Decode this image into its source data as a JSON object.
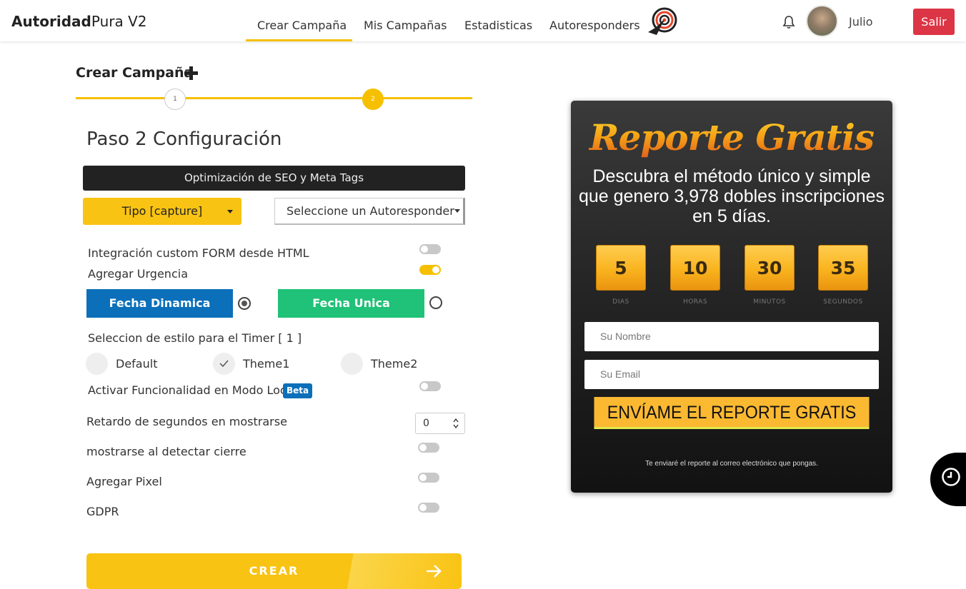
{
  "brand": {
    "bold": "Autoridad",
    "light": "Pura V2"
  },
  "nav": {
    "links": [
      "Crear Campaña",
      "Mis Campañas",
      "Estadisticas",
      "Autoresponders"
    ],
    "user": "Julio",
    "logout": "Salir",
    "accent": "#f6c000"
  },
  "form": {
    "title": "Crear Campaña",
    "steps": [
      "1",
      "2"
    ],
    "heading": "Paso 2 Configuración",
    "seo_bar": "Optimización de SEO y Meta Tags",
    "tipo": "Tipo [capture]",
    "autoresponder": "Seleccione un Autoresponder",
    "custom_form": "Integración custom FORM desde HTML",
    "urgencia": "Agregar Urgencia",
    "fecha_dinamica": "Fecha Dinamica",
    "fecha_unica": "Fecha Unica",
    "timer_style": "Seleccion de estilo para el Timer [ 1 ]",
    "themes": [
      "Default",
      "Theme1",
      "Theme2"
    ],
    "lock_mode": "Activar Funcionalidad en Modo Lock",
    "beta": "Beta",
    "retardo": "Retardo de segundos en mostrarse",
    "retardo_value": "0",
    "cierre": "mostrarse al detectar cierre",
    "pixel": "Agregar Pixel",
    "gdpr": "GDPR",
    "submit": "CREAR",
    "toggles": {
      "custom_form": false,
      "urgencia": true,
      "lock_mode": false,
      "cierre": false,
      "pixel": false,
      "gdpr": false
    },
    "selected_date_mode": "Fecha Dinamica",
    "selected_theme": "Theme1"
  },
  "preview": {
    "title": "Reporte Gratis",
    "subtitle": "Descubra el método único y simple que genero 3,978 dobles inscripciones en 5 días.",
    "countdown": [
      {
        "value": "5",
        "label": "DIAS"
      },
      {
        "value": "10",
        "label": "HORAS"
      },
      {
        "value": "30",
        "label": "MINUTOS"
      },
      {
        "value": "35",
        "label": "SEGUNDOS"
      }
    ],
    "name_placeholder": "Su Nombre",
    "email_placeholder": "Su Email",
    "cta": "ENVÍAME EL REPORTE GRATIS",
    "footer": "Te enviaré el reporte al correo electrónico que pongas."
  }
}
